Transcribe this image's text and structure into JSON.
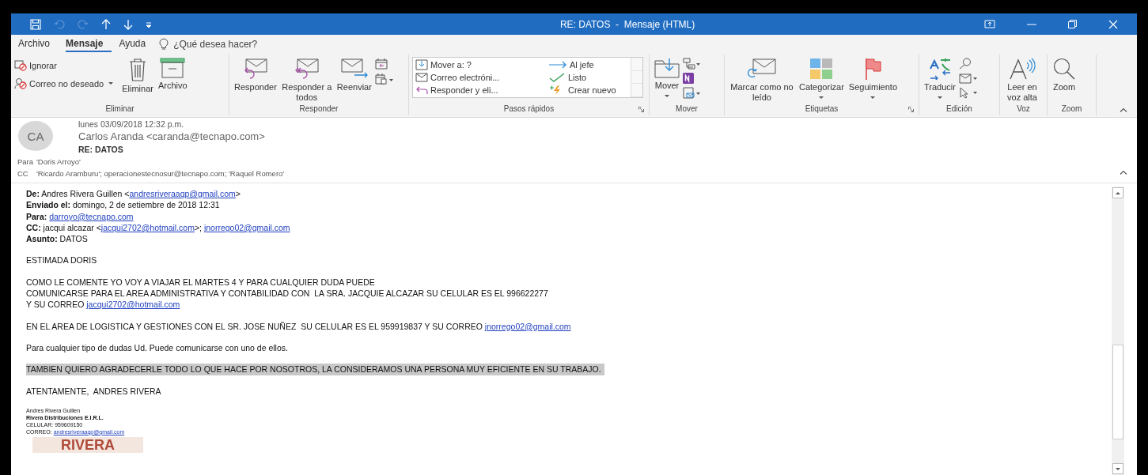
{
  "window": {
    "title": "RE: DATOS  -  Mensaje (HTML)"
  },
  "menu_tabs": [
    {
      "label": "Archivo",
      "selected": false
    },
    {
      "label": "Mensaje",
      "selected": true
    },
    {
      "label": "Ayuda",
      "selected": false
    }
  ],
  "search": {
    "placeholder": "¿Qué desea hacer?"
  },
  "ribbon": {
    "groups": [
      {
        "label": "Eliminar",
        "buttons": [
          "Ignorar",
          "Correo no deseado",
          "Eliminar",
          "Archivo"
        ]
      },
      {
        "label": "Responder",
        "buttons": [
          "Responder",
          "Responder a todos",
          "Reenviar"
        ]
      },
      {
        "label": "Pasos rápidos",
        "steps": [
          "Mover a: ?",
          "Al jefe",
          "Correo electróni...",
          "Listo",
          "Responder y eli...",
          "Crear nuevo"
        ]
      },
      {
        "label": "Mover",
        "buttons": [
          "Mover"
        ]
      },
      {
        "label": "Etiquetas",
        "buttons": [
          "Marcar como no leído",
          "Categorizar",
          "Seguimiento"
        ]
      },
      {
        "label": "Edición",
        "buttons": [
          "Traducir"
        ]
      },
      {
        "label": "Voz",
        "buttons": [
          "Leer en voz alta"
        ]
      },
      {
        "label": "Zoom",
        "buttons": [
          "Zoom"
        ]
      }
    ]
  },
  "message": {
    "avatar": "CA",
    "date": "lunes 03/09/2018 12:32 p.m.",
    "sender": "Carlos Aranda <caranda@tecnapo.com>",
    "subject": "RE: DATOS",
    "recipients": [
      {
        "label": "Para",
        "value": "'Doris Arroyo'"
      },
      {
        "label": "CC",
        "value": "'Ricardo Aramburu'; operacionestecnosur@tecnapo.com; 'Raquel Romero'"
      }
    ]
  },
  "body": {
    "forward_header": [
      {
        "label": "De:",
        "segments": [
          {
            "kind": "text",
            "text": "Andres Rivera Guillen <"
          },
          {
            "kind": "link",
            "text": "andresriveraaqp@gmail.com"
          },
          {
            "kind": "text",
            "text": ">"
          }
        ]
      },
      {
        "label": "Enviado el:",
        "segments": [
          {
            "kind": "text",
            "text": "domingo, 2 de setiembre de 2018 12:31"
          }
        ]
      },
      {
        "label": "Para:",
        "segments": [
          {
            "kind": "link",
            "text": "darroyo@tecnapo.com"
          }
        ]
      },
      {
        "label": "CC:",
        "segments": [
          {
            "kind": "text",
            "text": "jacqui alcazar <"
          },
          {
            "kind": "link",
            "text": "jacqui2702@hotmail.com"
          },
          {
            "kind": "text",
            "text": ">; "
          },
          {
            "kind": "link",
            "text": "jnorrego02@gmail.com"
          }
        ]
      },
      {
        "label": "Asunto:",
        "segments": [
          {
            "kind": "text",
            "text": "DATOS"
          }
        ]
      }
    ],
    "paragraphs": [
      {
        "highlighted": false,
        "lines": [
          [
            {
              "kind": "text",
              "text": "ESTIMADA DORIS"
            }
          ]
        ]
      },
      {
        "highlighted": false,
        "lines": [
          [
            {
              "kind": "text",
              "text": "COMO LE COMENTE YO VOY A VIAJAR EL MARTES 4 Y PARA CUALQUIER DUDA PUEDE"
            }
          ],
          [
            {
              "kind": "text",
              "text": "COMUNICARSE PARA EL AREA ADMINISTRATIVA Y CONTABILIDAD CON  LA SRA. JACQUIE ALCAZAR SU CELULAR ES EL 996622277"
            }
          ],
          [
            {
              "kind": "text",
              "text": "Y SU CORREO "
            },
            {
              "kind": "link",
              "text": "jacqui2702@hotmail.com"
            }
          ]
        ]
      },
      {
        "highlighted": false,
        "lines": [
          [
            {
              "kind": "text",
              "text": "EN EL AREA DE LOGISTICA Y GESTIONES CON EL SR. JOSE NUÑEZ  SU CELULAR ES EL 959919837 Y SU CORREO "
            },
            {
              "kind": "link",
              "text": "jnorrego02@gmail.com"
            }
          ]
        ]
      },
      {
        "highlighted": false,
        "lines": [
          [
            {
              "kind": "text",
              "text": "Para cualquier tipo de dudas Ud. Puede comunicarse con uno de ellos."
            }
          ]
        ]
      },
      {
        "highlighted": true,
        "lines": [
          [
            {
              "kind": "text",
              "text": "TAMBIEN QUIERO AGRADECERLE TODO LO QUE HACE POR NOSOTROS, LA CONSIDERAMOS UNA PERSONA MUY EFICIENTE EN SU TRABAJO."
            }
          ]
        ]
      },
      {
        "highlighted": false,
        "lines": [
          [
            {
              "kind": "text",
              "text": "ATENTAMENTE,  ANDRES RIVERA"
            }
          ]
        ]
      }
    ],
    "signature": [
      {
        "bold": false,
        "segments": [
          {
            "kind": "text",
            "text": "Andres Rivera Guillen"
          }
        ]
      },
      {
        "bold": true,
        "segments": [
          {
            "kind": "text",
            "text": "Rivera Distribuciones E.I.R.L."
          }
        ]
      },
      {
        "bold": false,
        "segments": [
          {
            "kind": "text",
            "text": "CELULAR: 959609150"
          }
        ]
      },
      {
        "bold": false,
        "segments": [
          {
            "kind": "text",
            "text": "CORREO: "
          },
          {
            "kind": "link",
            "text": "andresriveraaqp@gmail.com"
          }
        ]
      }
    ],
    "logo": "RIVERA"
  }
}
